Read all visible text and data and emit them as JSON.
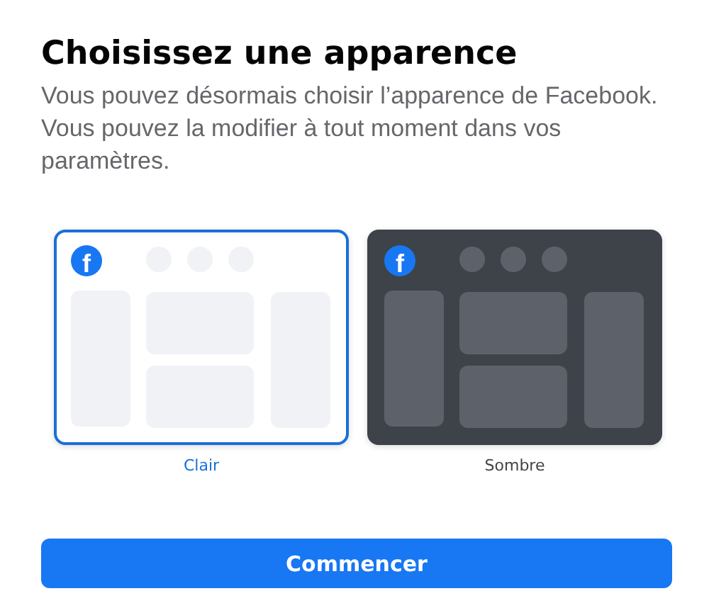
{
  "title": "Choisissez une apparence",
  "description": "Vous pouvez désormais choisir l’apparence de Facebook. Vous pouvez la modifier à tout moment dans vos paramètres.",
  "options": [
    {
      "kind": "light",
      "label": "Clair",
      "logo": "f",
      "selected": true
    },
    {
      "kind": "dark",
      "label": "Sombre",
      "logo": "f",
      "selected": false
    }
  ],
  "button": "Commencer"
}
